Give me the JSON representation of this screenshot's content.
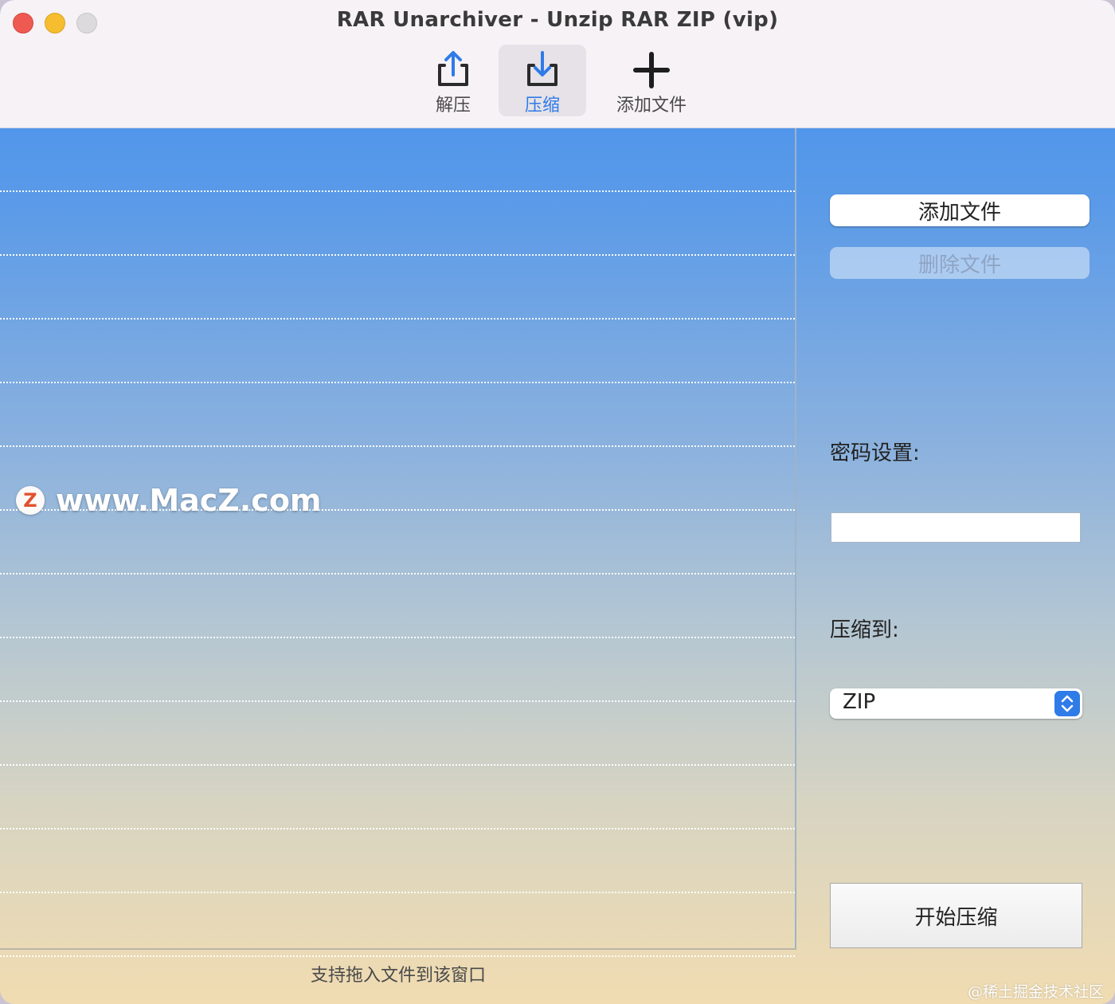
{
  "window": {
    "title": "RAR Unarchiver - Unzip RAR ZIP (vip)"
  },
  "toolbar": {
    "extract_label": "解压",
    "compress_label": "压缩",
    "add_files_label": "添加文件",
    "active_tab": "compress",
    "accent_color": "#2f7be8"
  },
  "file_list": {
    "rows": 13,
    "watermark_logo": "Z",
    "watermark_text": "www.MacZ.com",
    "drop_hint": "支持拖入文件到该窗口"
  },
  "side_panel": {
    "add_file_button": "添加文件",
    "delete_file_button": "删除文件",
    "password_label": "密码设置:",
    "password_value": "",
    "compress_to_label": "压缩到:",
    "format_value": "ZIP",
    "start_button": "开始压缩"
  },
  "corner_watermark": "@稀土掘金技术社区"
}
